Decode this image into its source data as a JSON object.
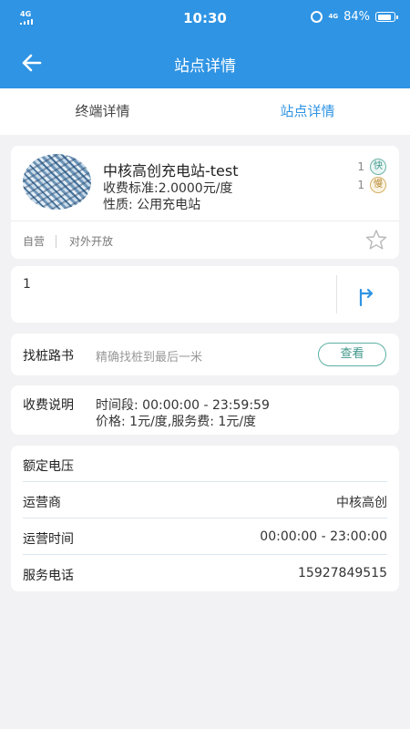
{
  "status_bar": {
    "network": "4G",
    "time": "10:30",
    "mini_network": "4G",
    "battery": "84%"
  },
  "header": {
    "title": "站点详情"
  },
  "tabs": [
    {
      "label": "终端详情",
      "active": false
    },
    {
      "label": "站点详情",
      "active": true
    }
  ],
  "station": {
    "name": "中核高创充电站-test",
    "fee": "收费标准:2.0000元/度",
    "nature": "性质: 公用充电站",
    "fast_count": "1",
    "fast_badge": "快",
    "slow_count": "1",
    "slow_badge": "慢",
    "tag_self": "自营",
    "tag_open": "对外开放"
  },
  "address": {
    "text": "1"
  },
  "guide": {
    "label": "找桩路书",
    "desc": "精确找桩到最后一米",
    "button": "查看"
  },
  "charge": {
    "label": "收费说明",
    "time_period": "时间段:  00:00:00 - 23:59:59",
    "price": "价格:   1元/度,服务费:  1元/度"
  },
  "info": {
    "rows": [
      {
        "key": "额定电压",
        "value": ""
      },
      {
        "key": "运营商",
        "value": "中核高创"
      },
      {
        "key": "运营时间",
        "value": "00:00:00 - 23:00:00"
      },
      {
        "key": "服务电话",
        "value": "15927849515"
      }
    ]
  },
  "colors": {
    "primary": "#2f94e4",
    "fast": "#3f978a",
    "slow": "#b68a33"
  }
}
